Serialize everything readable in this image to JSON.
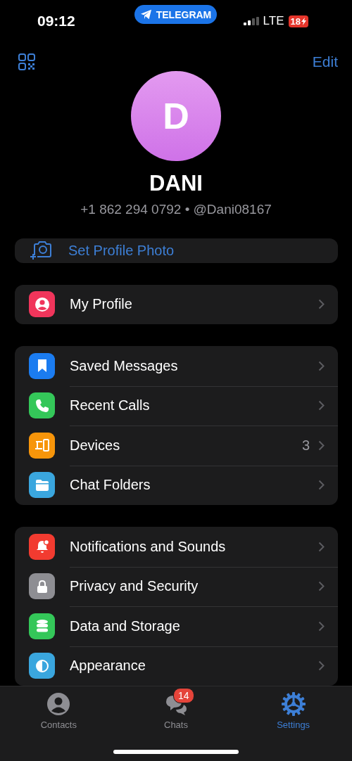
{
  "status_bar": {
    "time": "09:12",
    "app_pill": "TELEGRAM",
    "network": "LTE",
    "battery": "18"
  },
  "header": {
    "edit": "Edit"
  },
  "profile": {
    "initial": "D",
    "name": "DANI",
    "info": "+1 862 294 0792 • @Dani08167"
  },
  "set_photo": {
    "label": "Set Profile Photo"
  },
  "groups": [
    [
      {
        "label": "My Profile",
        "kind": "profile",
        "color": "#f0355b"
      }
    ],
    [
      {
        "label": "Saved Messages",
        "kind": "bookmark",
        "color": "#1b7cf0"
      },
      {
        "label": "Recent Calls",
        "kind": "phone",
        "color": "#34c759"
      },
      {
        "label": "Devices",
        "kind": "devices",
        "color": "#f7950a",
        "value": "3"
      },
      {
        "label": "Chat Folders",
        "kind": "folder",
        "color": "#3aa6de"
      }
    ],
    [
      {
        "label": "Notifications and Sounds",
        "kind": "bell",
        "color": "#f23b30"
      },
      {
        "label": "Privacy and Security",
        "kind": "lock",
        "color": "#8e8e93"
      },
      {
        "label": "Data and Storage",
        "kind": "data",
        "color": "#34c759"
      },
      {
        "label": "Appearance",
        "kind": "appearance",
        "color": "#3aa6de"
      }
    ]
  ],
  "tabs": [
    {
      "label": "Contacts",
      "kind": "contacts",
      "selected": false
    },
    {
      "label": "Chats",
      "kind": "chats",
      "selected": false,
      "badge": "14"
    },
    {
      "label": "Settings",
      "kind": "settings",
      "selected": true
    }
  ]
}
